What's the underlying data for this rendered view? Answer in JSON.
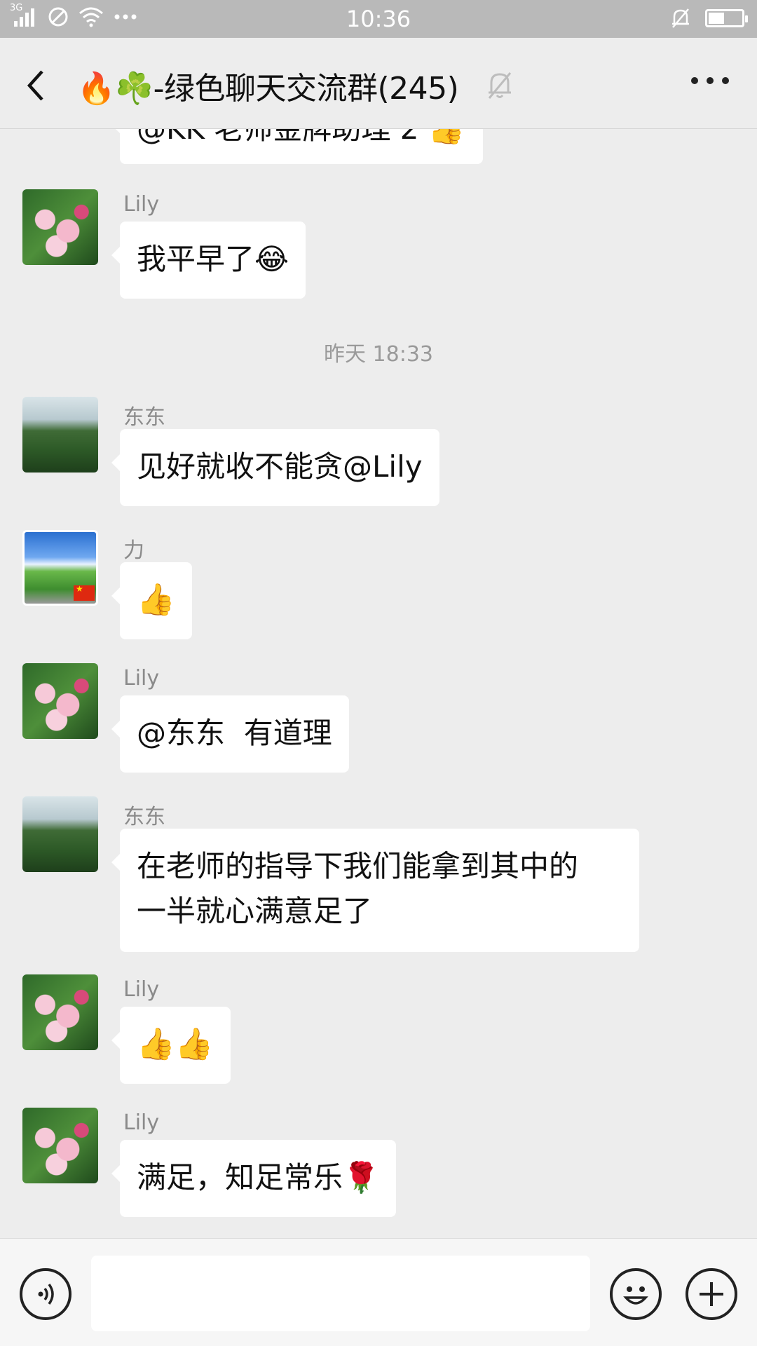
{
  "status_bar": {
    "network": "3G",
    "time": "10:36"
  },
  "header": {
    "title_emoji": "🔥☘️",
    "title": "-绿色聊天交流群(245)"
  },
  "messages": [
    {
      "sender": "",
      "text": "@KK 老师金牌助理 2 👍"
    },
    {
      "sender": "Lily",
      "text": "我平早了😂"
    },
    {
      "timestamp": "昨天 18:33"
    },
    {
      "sender": "东东",
      "text": "见好就收不能贪@Lily"
    },
    {
      "sender": "力",
      "text": "👍"
    },
    {
      "sender": "Lily",
      "text": "@东东  有道理"
    },
    {
      "sender": "东东",
      "text_line1": "在老师的指导下我们能拿到其中的",
      "text_line2": "一半就心满意足了"
    },
    {
      "sender": "Lily",
      "text": "👍👍"
    },
    {
      "sender": "Lily",
      "text": "满足，知足常乐🌹"
    }
  ],
  "input": {
    "placeholder": ""
  },
  "colors": {
    "background": "#ededed",
    "bubble": "#ffffff",
    "status_bar": "#b9b9b9"
  }
}
